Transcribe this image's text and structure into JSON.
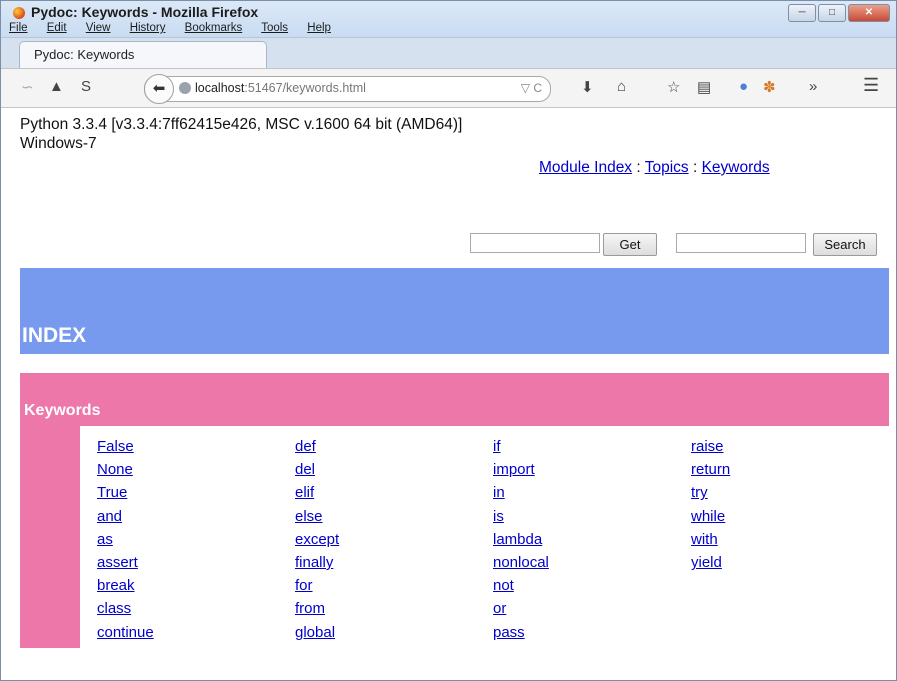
{
  "window": {
    "title": "Pydoc: Keywords - Mozilla Firefox",
    "menu": [
      "File",
      "Edit",
      "View",
      "History",
      "Bookmarks",
      "Tools",
      "Help"
    ]
  },
  "tab": {
    "label": "Pydoc: Keywords"
  },
  "url": {
    "host": "localhost",
    "rest": ":51467/keywords.html"
  },
  "page": {
    "version_line1": "Python 3.3.4 [v3.3.4:7ff62415e426, MSC v.1600 64 bit (AMD64)]",
    "version_line2": "Windows-7",
    "links": {
      "module_index": "Module Index",
      "sep": " : ",
      "topics": "Topics",
      "keywords": "Keywords"
    },
    "get_label": "Get",
    "search_label": "Search",
    "index_heading": "INDEX",
    "keywords_heading": "Keywords",
    "keyword_columns": [
      [
        "False",
        "None",
        "True",
        "and",
        "as",
        "assert",
        "break",
        "class",
        "continue"
      ],
      [
        "def",
        "del",
        "elif",
        "else",
        "except",
        "finally",
        "for",
        "from",
        "global"
      ],
      [
        "if",
        "import",
        "in",
        "is",
        "lambda",
        "nonlocal",
        "not",
        "or",
        "pass"
      ],
      [
        "raise",
        "return",
        "try",
        "while",
        "with",
        "yield"
      ]
    ]
  },
  "colors": {
    "index_band": "#7799ee",
    "keywords_band": "#ee77aa",
    "link": "#0000cc"
  }
}
